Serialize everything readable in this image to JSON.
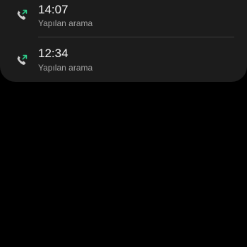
{
  "call_log": {
    "entries": [
      {
        "time": "14:07",
        "type": "Yapılan arama",
        "icon": "outgoing-call-icon"
      },
      {
        "time": "12:34",
        "type": "Yapılan arama",
        "icon": "outgoing-call-icon"
      }
    ]
  },
  "colors": {
    "background": "#000000",
    "card": "#1c1c1c",
    "icon_phone": "#cfcfcf",
    "icon_arrow": "#2ecc8a"
  }
}
